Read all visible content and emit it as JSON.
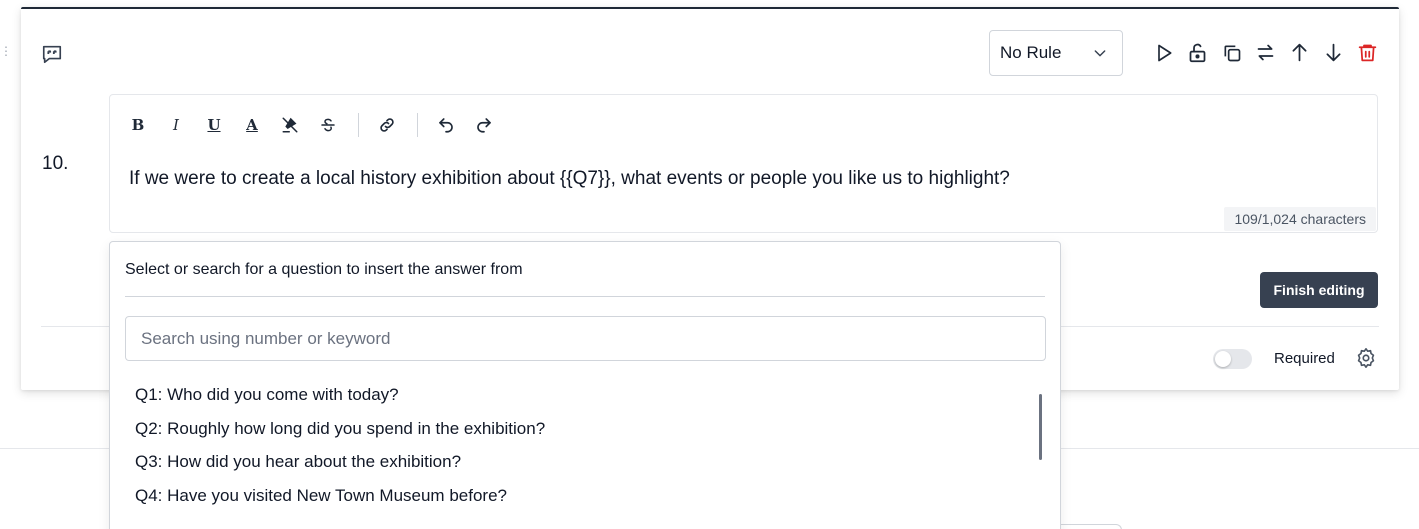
{
  "background": {
    "dots": "⋮"
  },
  "question": {
    "number": "10.",
    "rule_select": {
      "value": "No Rule"
    },
    "text": "If we were to create a local history exhibition about {{Q7}}, what events or people you like us to highlight?",
    "char_count": "109/1,024 characters",
    "finish_label": "Finish editing",
    "required_label": "Required",
    "required_on": false
  },
  "formatting": {
    "bold": "B",
    "italic": "I",
    "underline": "U",
    "text_color": "A"
  },
  "actions": [
    "play-icon",
    "unlock-icon",
    "copy-icon",
    "swap-icon",
    "arrow-up-icon",
    "arrow-down-icon",
    "trash-icon"
  ],
  "popup": {
    "title": "Select or search for a question to insert the answer from",
    "search_placeholder": "Search using number or keyword",
    "items": [
      "Q1: Who did you come with today?",
      "Q2: Roughly how long did you spend in the exhibition?",
      "Q3: How did you hear about the exhibition?",
      "Q4: Have you visited New Town Museum before?"
    ]
  },
  "colors": {
    "accent_dark": "#374151",
    "delete_red": "#dc2626",
    "border": "#d1d5db"
  }
}
